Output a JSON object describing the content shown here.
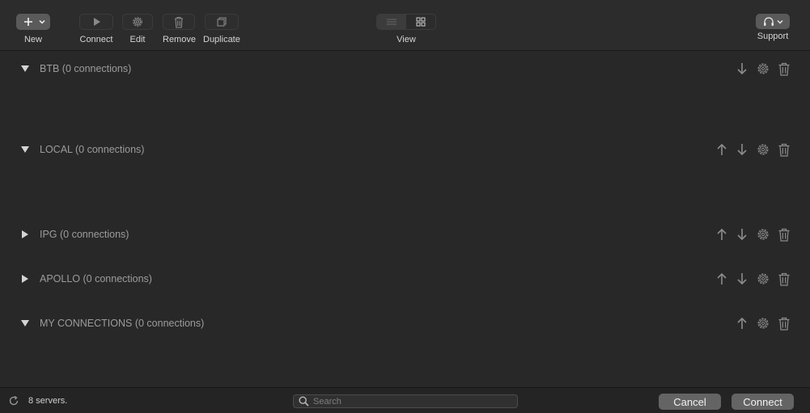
{
  "toolbar": {
    "new_label": "New",
    "connect_label": "Connect",
    "edit_label": "Edit",
    "remove_label": "Remove",
    "duplicate_label": "Duplicate",
    "view_label": "View",
    "support_label": "Support"
  },
  "groups": [
    {
      "title": "BTB (0 connections)",
      "expanded": true,
      "actions": [
        "arrow-down",
        "gear",
        "trash"
      ]
    },
    {
      "title": "LOCAL (0 connections)",
      "expanded": true,
      "actions": [
        "arrow-up",
        "arrow-down",
        "gear",
        "trash"
      ]
    },
    {
      "title": "IPG (0 connections)",
      "expanded": false,
      "actions": [
        "arrow-up",
        "arrow-down",
        "gear",
        "trash"
      ]
    },
    {
      "title": "APOLLO (0 connections)",
      "expanded": false,
      "actions": [
        "arrow-up",
        "arrow-down",
        "gear",
        "trash"
      ]
    },
    {
      "title": "MY CONNECTIONS (0 connections)",
      "expanded": true,
      "actions": [
        "arrow-up",
        "gear",
        "trash"
      ]
    }
  ],
  "footer": {
    "status": "8 servers.",
    "search_placeholder": "Search",
    "cancel_label": "Cancel",
    "connect_label": "Connect"
  }
}
